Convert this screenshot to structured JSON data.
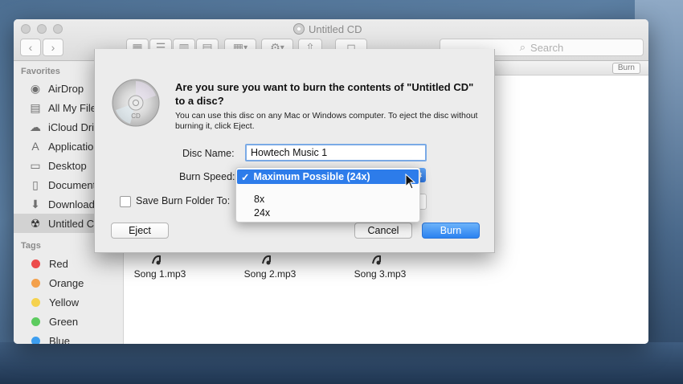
{
  "window": {
    "title": "Untitled CD",
    "search_placeholder": "Search"
  },
  "toolbar": {
    "back": "‹",
    "forward": "›",
    "view_icon": "▦",
    "list_icon": "☰",
    "column_icon": "▥",
    "cover_icon": "▤",
    "arrange_icon": "▦",
    "action_icon": "⚙",
    "share_icon": "⇧",
    "tag_icon": "◻",
    "dropdown": "▾",
    "search_icon": "⌕"
  },
  "sidebar": {
    "favorites_label": "Favorites",
    "favorites": [
      {
        "label": "AirDrop",
        "icon": "airdrop-icon",
        "glyph": "◉"
      },
      {
        "label": "All My Files",
        "icon": "all-files-icon",
        "glyph": "▤"
      },
      {
        "label": "iCloud Drive",
        "icon": "cloud-icon",
        "glyph": "☁"
      },
      {
        "label": "Applications",
        "icon": "applications-icon",
        "glyph": "A"
      },
      {
        "label": "Desktop",
        "icon": "desktop-icon",
        "glyph": "▭"
      },
      {
        "label": "Documents",
        "icon": "documents-icon",
        "glyph": "▯"
      },
      {
        "label": "Downloads",
        "icon": "downloads-icon",
        "glyph": "⬇"
      },
      {
        "label": "Untitled CD",
        "icon": "burn-disc-icon",
        "glyph": "☢"
      }
    ],
    "tags_label": "Tags",
    "tags": [
      {
        "label": "Red",
        "color": "#ec4b4b"
      },
      {
        "label": "Orange",
        "color": "#f3a04b"
      },
      {
        "label": "Yellow",
        "color": "#f5d24e"
      },
      {
        "label": "Green",
        "color": "#5ccb5f"
      },
      {
        "label": "Blue",
        "color": "#3d9ef0"
      }
    ]
  },
  "content": {
    "burn_button": "Burn",
    "files": [
      "Song 1.mp3",
      "Song 2.mp3",
      "Song 3.mp3"
    ]
  },
  "dialog": {
    "title": "Are you sure you want to burn the contents of \"Untitled CD\" to a disc?",
    "message": "You can use this disc on any Mac or Windows computer. To eject the disc without burning it, click Eject.",
    "disc_name_label": "Disc Name:",
    "disc_name_value": "Howtech Music 1",
    "burn_speed_label": "Burn Speed:",
    "save_folder_label": "Save Burn Folder To:",
    "eject_button": "Eject",
    "cancel_button": "Cancel",
    "burn_button": "Burn"
  },
  "speed_menu": {
    "checkmark": "✓",
    "selected": "Maximum Possible (24x)",
    "options": [
      "8x",
      "24x"
    ],
    "stepper": "⬍"
  }
}
